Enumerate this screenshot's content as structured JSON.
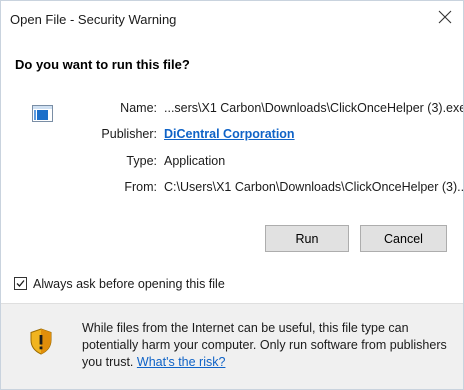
{
  "window": {
    "title": "Open File - Security Warning"
  },
  "heading": "Do you want to run this file?",
  "file_info": {
    "name_label": "Name:",
    "name_value": "...sers\\X1 Carbon\\Downloads\\ClickOnceHelper (3).exe",
    "publisher_label": "Publisher:",
    "publisher_value": "DiCentral Corporation",
    "type_label": "Type:",
    "type_value": "Application",
    "from_label": "From:",
    "from_value": "C:\\Users\\X1 Carbon\\Downloads\\ClickOnceHelper (3)..."
  },
  "buttons": {
    "run_label": "Run",
    "cancel_label": "Cancel"
  },
  "checkbox": {
    "label": "Always ask before opening this file",
    "checked": true
  },
  "footer": {
    "warning_text": "While files from the Internet can be useful, this file type can potentially harm your computer. Only run software from publishers you trust.",
    "risk_link": "What's the risk?"
  },
  "icons": {
    "close": "close-icon",
    "file": "application-file-icon",
    "shield": "security-shield-icon",
    "check": "checkmark-icon"
  },
  "colors": {
    "link": "#0f63c7",
    "footer_bg": "#f0f0f0",
    "button_bg": "#e1e1e1"
  }
}
